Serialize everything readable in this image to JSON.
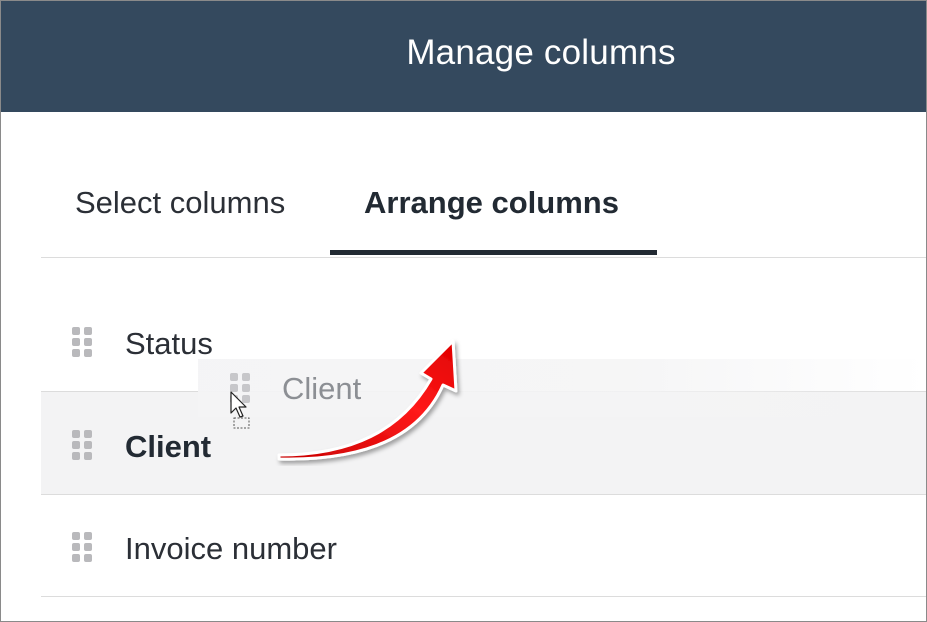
{
  "dialog": {
    "title": "Manage columns"
  },
  "tabs": [
    {
      "label": "Select columns",
      "active": false
    },
    {
      "label": "Arrange columns",
      "active": true
    }
  ],
  "columns": [
    {
      "label": "Status"
    },
    {
      "label": "Client"
    },
    {
      "label": "Invoice number"
    }
  ],
  "drag": {
    "ghost_label": "Client"
  },
  "colors": {
    "header_bg": "#34495e",
    "active_tab_underline": "#222a33",
    "annotation_arrow": "#e01010",
    "selected_row_bg": "#f3f3f4"
  },
  "icons": {
    "handle": "drag-handle-icon",
    "cursor": "drag-cursor-icon",
    "annotation": "curved-arrow-icon"
  }
}
